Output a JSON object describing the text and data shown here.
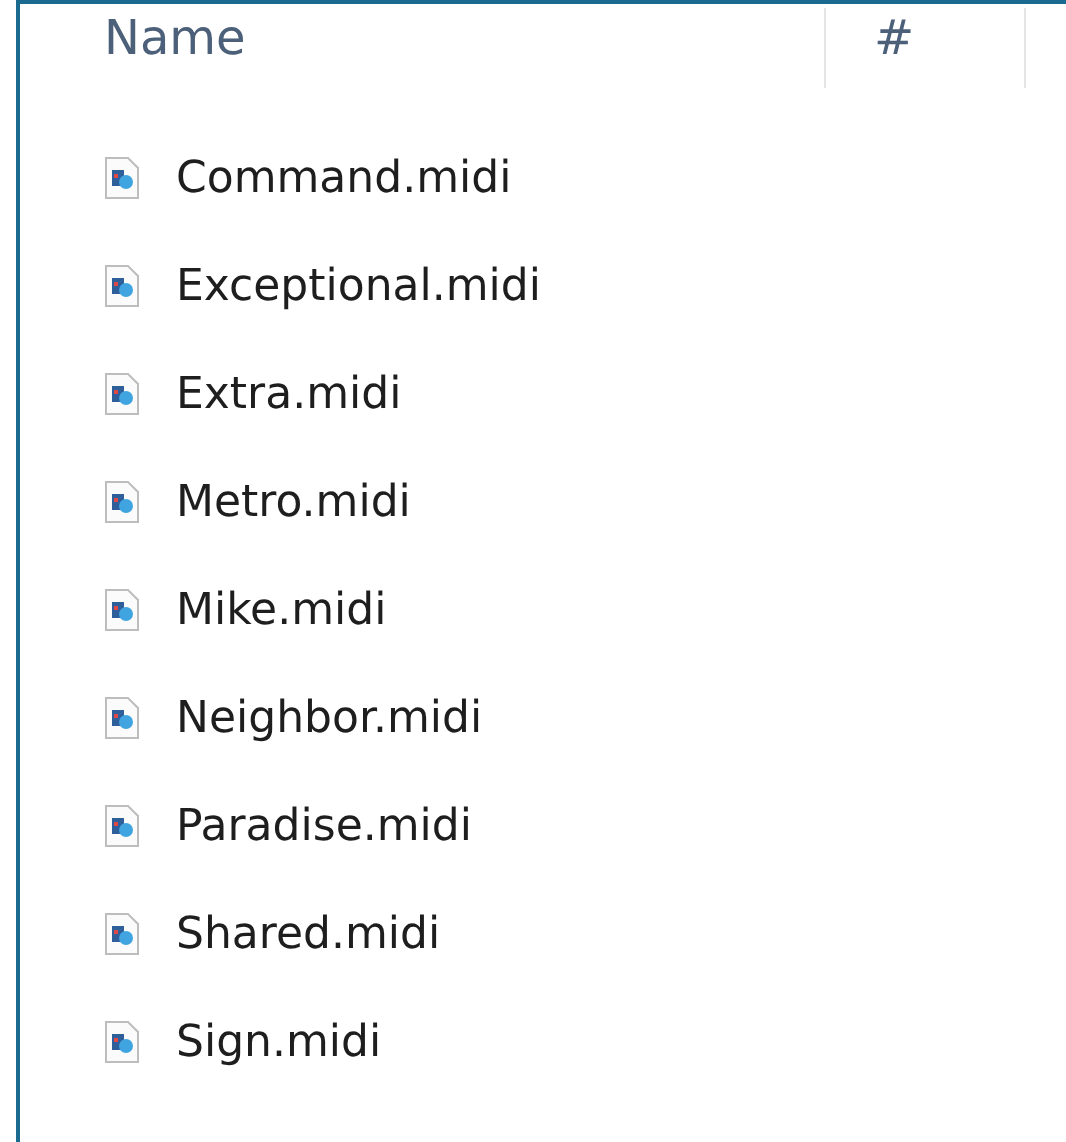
{
  "columns": [
    "Name",
    "#"
  ],
  "files": [
    {
      "name": "Command.midi"
    },
    {
      "name": "Exceptional.midi"
    },
    {
      "name": "Extra.midi"
    },
    {
      "name": "Metro.midi"
    },
    {
      "name": "Mike.midi"
    },
    {
      "name": "Neighbor.midi"
    },
    {
      "name": "Paradise.midi"
    },
    {
      "name": "Shared.midi"
    },
    {
      "name": "Sign.midi"
    }
  ]
}
